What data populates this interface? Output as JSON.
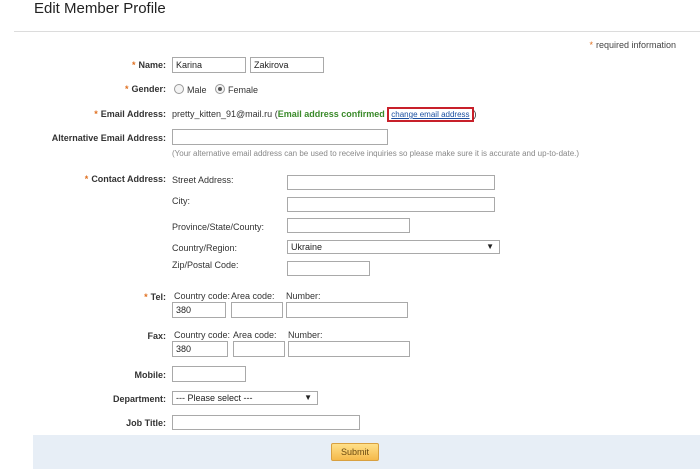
{
  "page": {
    "title": "Edit Member Profile",
    "required_info": "required information"
  },
  "required_mark": "*",
  "name": {
    "label": "Name:",
    "first": "Karina",
    "last": "Zakirova"
  },
  "gender": {
    "label": "Gender:",
    "male": "Male",
    "female": "Female",
    "selected": "Female"
  },
  "email": {
    "label": "Email Address:",
    "value": "pretty_kitten_91@mail.ru",
    "open_paren": "(",
    "confirmed": "Email address confirmed",
    "change_link": "change email address",
    "close_paren": ")"
  },
  "alt_email": {
    "label": "Alternative Email Address:",
    "value": "",
    "note": "(Your alternative email address can be used to receive inquiries so please make sure it is accurate and up-to-date.)"
  },
  "contact": {
    "label": "Contact Address:",
    "street_label": "Street Address:",
    "street_value": "",
    "city_label": "City:",
    "city_value": "",
    "province_label": "Province/State/County:",
    "province_value": "",
    "country_label": "Country/Region:",
    "country_value": "Ukraine",
    "zip_label": "Zip/Postal Code:",
    "zip_value": ""
  },
  "tel": {
    "label": "Tel:",
    "country_code_label": "Country code:",
    "area_code_label": "Area code:",
    "number_label": "Number:",
    "country_code": "380",
    "area_code": "",
    "number": ""
  },
  "fax": {
    "label": "Fax:",
    "country_code_label": "Country code:",
    "area_code_label": "Area code:",
    "number_label": "Number:",
    "country_code": "380",
    "area_code": "",
    "number": ""
  },
  "mobile": {
    "label": "Mobile:",
    "value": ""
  },
  "department": {
    "label": "Department:",
    "value": "--- Please select ---"
  },
  "job_title": {
    "label": "Job Title:",
    "value": ""
  },
  "submit_label": "Submit",
  "colors": {
    "required_star": "#e07020",
    "confirmed_text": "#3a8a2a",
    "highlight_box": "#c8202a",
    "footer_bg": "#e7eef6"
  },
  "icons": {
    "dropdown": "chevron-down-icon",
    "radio": "radio-icon"
  }
}
